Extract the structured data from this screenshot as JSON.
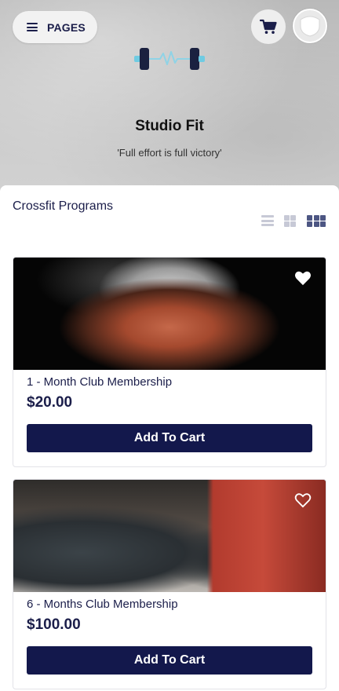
{
  "header": {
    "pages_label": "PAGES",
    "studio_name": "Studio Fit",
    "tagline": "'Full effort is full victory'"
  },
  "section": {
    "title": "Crossfit Programs"
  },
  "products": [
    {
      "title": "1 - Month Club Membership",
      "price": "$20.00",
      "button_label": "Add To Cart"
    },
    {
      "title": "6 - Months Club Membership",
      "price": "$100.00",
      "button_label": "Add To Cart"
    }
  ],
  "colors": {
    "primary": "#13184c",
    "text_dark": "#1b1e4a",
    "logo_accent": "#8fd3e6"
  },
  "icons": [
    "menu-icon",
    "cart-icon",
    "avatar-icon",
    "dumbbell-logo",
    "list-view-icon",
    "grid-2-icon",
    "grid-3-icon",
    "heart-icon"
  ]
}
